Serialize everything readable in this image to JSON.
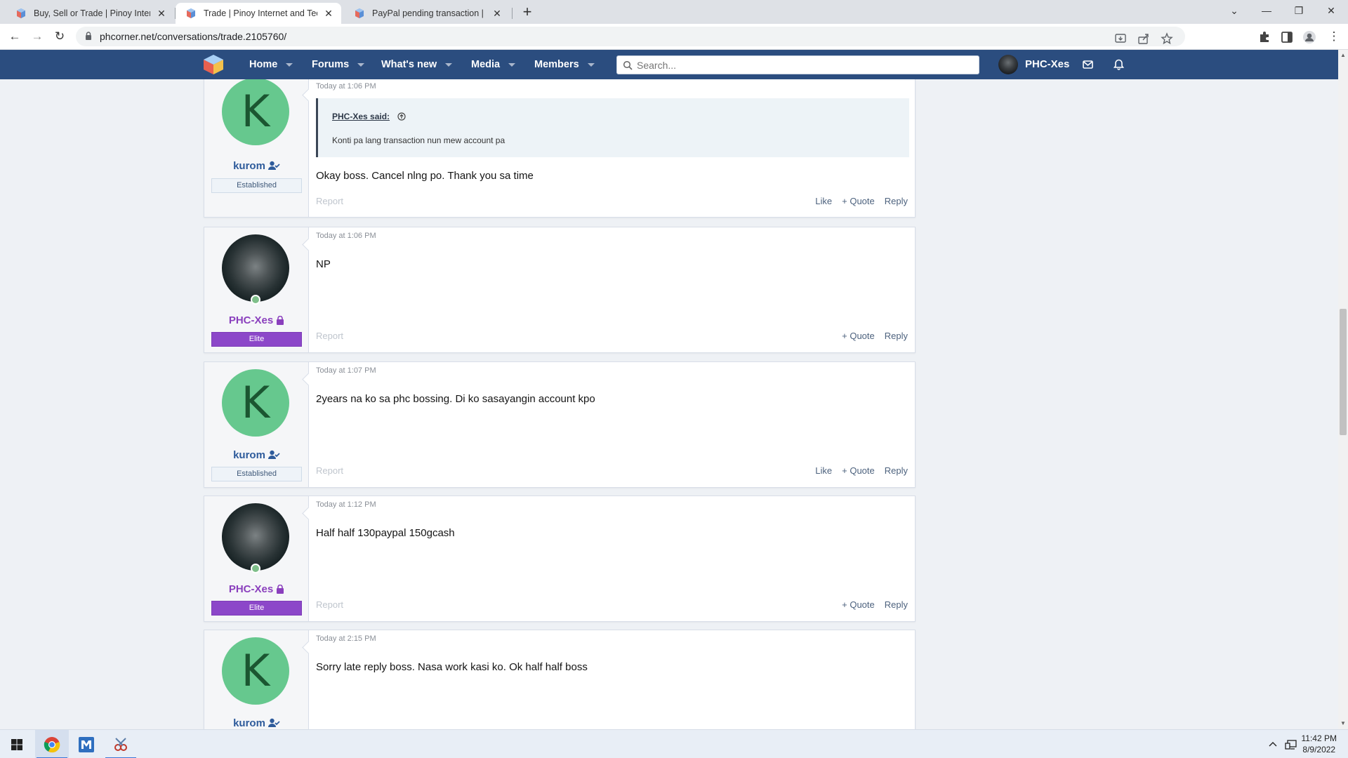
{
  "browser": {
    "tabs": [
      {
        "title": "Buy, Sell or Trade | Pinoy Internet",
        "active": false
      },
      {
        "title": "Trade | Pinoy Internet and Techno",
        "active": true
      },
      {
        "title": "PayPal pending transaction | Pinoy",
        "active": false
      }
    ],
    "url": "phcorner.net/conversations/trade.2105760/"
  },
  "site": {
    "nav": [
      "Home",
      "Forums",
      "What's new",
      "Media",
      "Members"
    ],
    "search_placeholder": "Search...",
    "username": "PHC-Xes"
  },
  "messages": [
    {
      "user": "kurom",
      "badge": "Established",
      "avatar": "K",
      "time": "Today at 1:06 PM",
      "quote": {
        "author": "PHC-Xes said:",
        "text": "Konti pa lang transaction nun mew account pa"
      },
      "body": "Okay boss. Cancel nlng po. Thank you sa time",
      "actions": {
        "report": "Report",
        "like": "Like",
        "quote": "Quote",
        "reply": "Reply"
      }
    },
    {
      "user": "PHC-Xes",
      "badge": "Elite",
      "time": "Today at 1:06 PM",
      "body": "NP",
      "actions": {
        "report": "Report",
        "quote": "Quote",
        "reply": "Reply"
      }
    },
    {
      "user": "kurom",
      "badge": "Established",
      "avatar": "K",
      "time": "Today at 1:07 PM",
      "body": "2years na ko sa phc bossing. Di ko sasayangin account kpo",
      "actions": {
        "report": "Report",
        "like": "Like",
        "quote": "Quote",
        "reply": "Reply"
      }
    },
    {
      "user": "PHC-Xes",
      "badge": "Elite",
      "time": "Today at 1:12 PM",
      "body": "Half half 130paypal 150gcash",
      "actions": {
        "report": "Report",
        "quote": "Quote",
        "reply": "Reply"
      }
    },
    {
      "user": "kurom",
      "avatar": "K",
      "time": "Today at 2:15 PM",
      "body": "Sorry late reply boss. Nasa work kasi ko. Ok half half boss"
    }
  ],
  "taskbar": {
    "time": "11:42 PM",
    "date": "8/9/2022"
  },
  "colors": {
    "header": "#2b4d7f",
    "elite": "#8c47c9",
    "avatar_k": "#66c88e",
    "username_blue": "#2e5b9b",
    "username_purple": "#8a3fbd"
  }
}
